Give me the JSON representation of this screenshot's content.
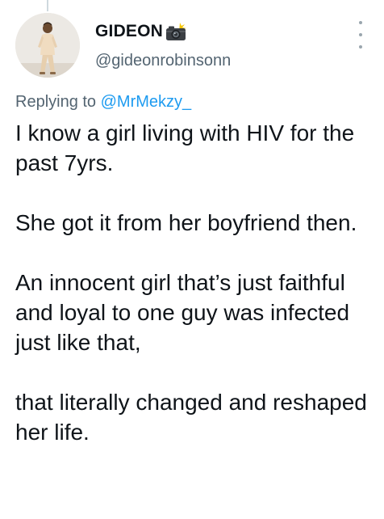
{
  "author": {
    "display_name": "GIDEON",
    "name_emoji": "camera-with-flash-icon",
    "handle": "@gideonrobinsonn",
    "avatar": "avatar-photo"
  },
  "reply": {
    "prefix": "Replying to",
    "mention": "@MrMekzy_"
  },
  "tweet": {
    "paragraphs": [
      "I know a girl living with HIV for the past 7yrs.",
      "She got it from her boyfriend then.",
      "An innocent girl that’s just faithful and loyal to one guy was infected just like that,",
      "that literally changed and reshaped her life."
    ]
  },
  "icons": {
    "more": "more-vertical-icon"
  },
  "colors": {
    "text": "#0f1419",
    "secondary": "#536471",
    "link": "#1d9bf0"
  }
}
